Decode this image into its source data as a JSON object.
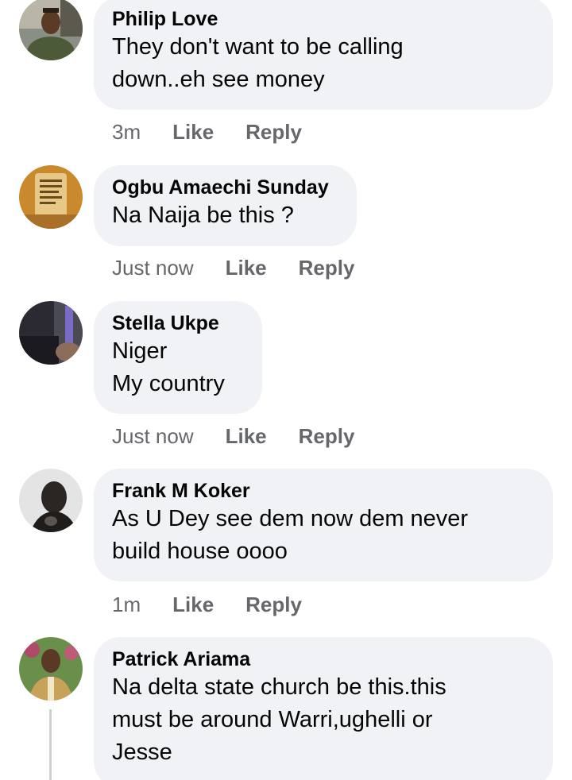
{
  "comments": [
    {
      "author": "Philip Love",
      "text": "They don't want to be calling\ndown..eh see money",
      "time": "3m",
      "like": "Like",
      "reply": "Reply",
      "avatar_icon": "avatar-philip-love"
    },
    {
      "author": "Ogbu Amaechi Sunday",
      "text": "Na Naija be this ?",
      "time": "Just now",
      "like": "Like",
      "reply": "Reply",
      "avatar_icon": "avatar-ogbu-amaechi-sunday"
    },
    {
      "author": "Stella Ukpe",
      "text": "Niger\nMy country",
      "time": "Just now",
      "like": "Like",
      "reply": "Reply",
      "avatar_icon": "avatar-stella-ukpe"
    },
    {
      "author": "Frank M Koker",
      "text": "As U Dey see dem now dem never\nbuild house oooo",
      "time": "1m",
      "like": "Like",
      "reply": "Reply",
      "avatar_icon": "avatar-frank-m-koker"
    },
    {
      "author": "Patrick Ariama",
      "text": "Na delta state church be this.this\nmust be around Warri,ughelli or\nJesse",
      "avatar_icon": "avatar-patrick-ariama"
    }
  ],
  "colors": {
    "bubble_bg": "#f0f2f5",
    "author_text": "#050505",
    "meta_text": "#65676b",
    "thread_line": "#ced0d4"
  }
}
